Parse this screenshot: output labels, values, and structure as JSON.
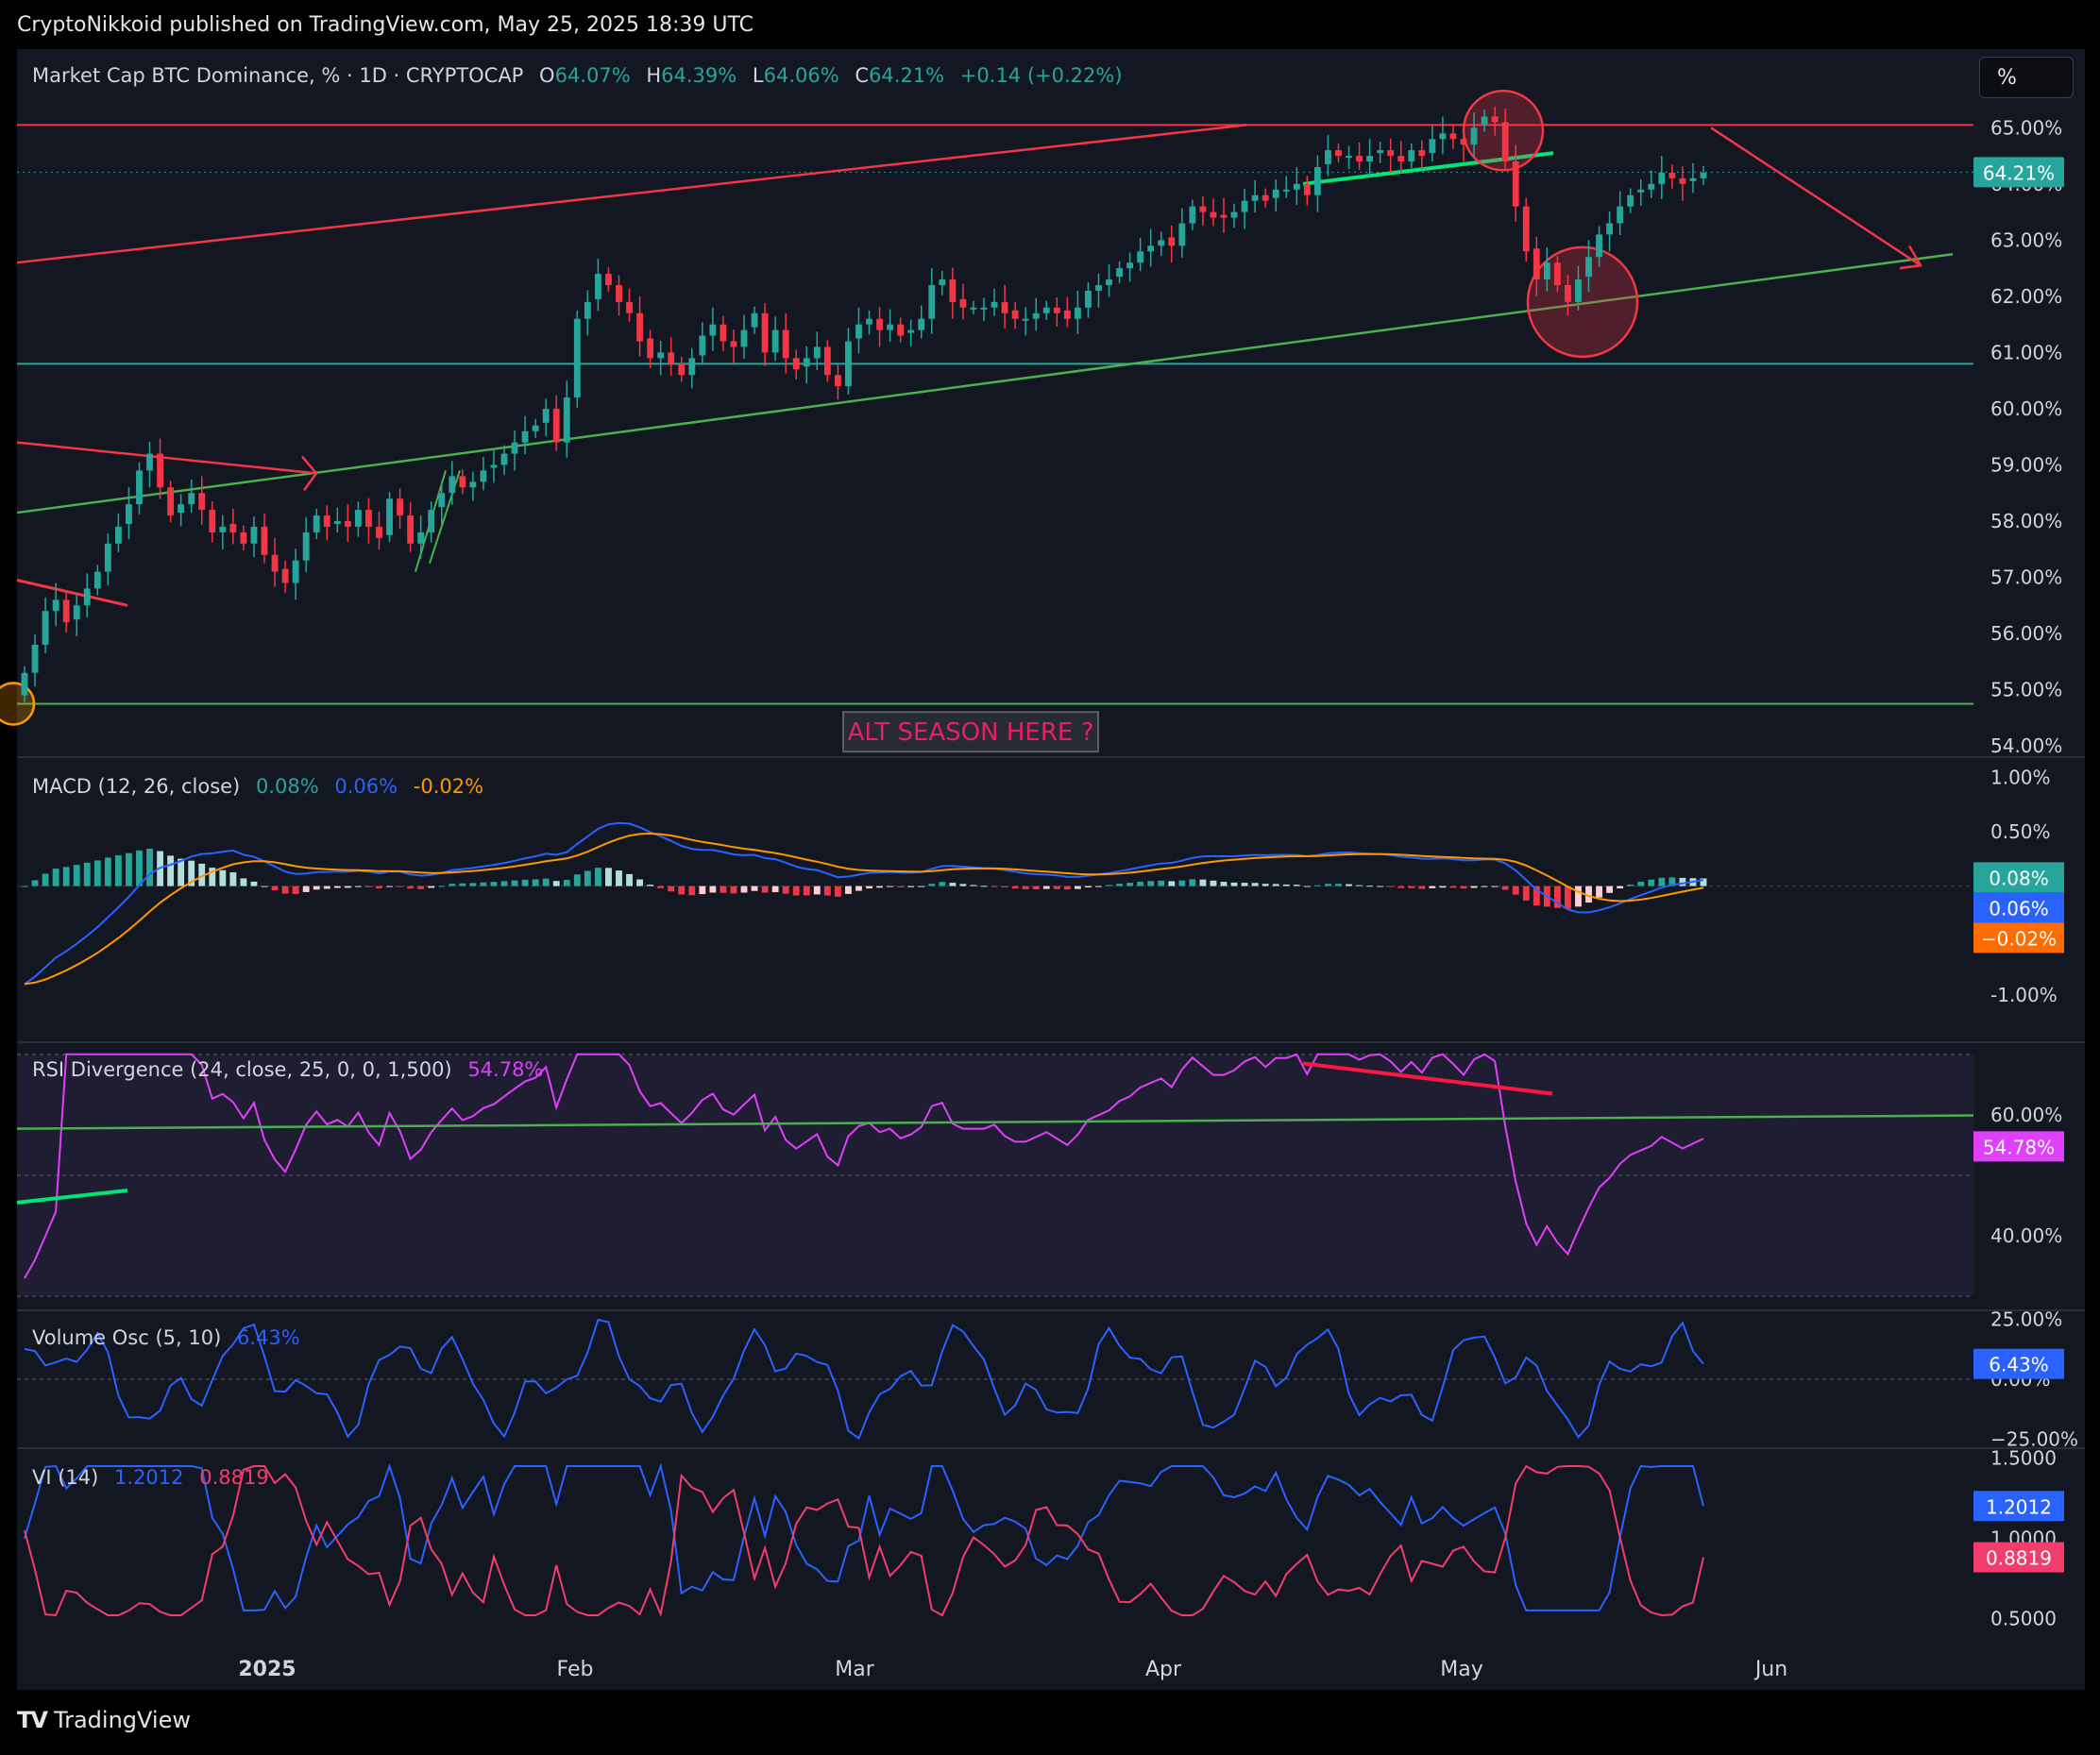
{
  "header": {
    "publisher_line": "CryptoNikkoid published on TradingView.com, May 25, 2025 18:39 UTC",
    "brand": "TradingView",
    "scale_button": "%"
  },
  "colors": {
    "background": "#131722",
    "up": "#26a69a",
    "down": "#f23645",
    "macd": "#2962ff",
    "signal": "#ff9800",
    "rsi": "#e040fb",
    "vosc": "#2962ff",
    "vi_plus": "#2962ff",
    "vi_minus": "#f23d6d",
    "trend_red": "#f23645",
    "trend_green": "#4caf50",
    "support_teal": "#26a69a",
    "annotation_pink": "#e91e63"
  },
  "chart_data": [
    {
      "type": "candlestick",
      "legend": {
        "title": "Market Cap BTC Dominance, % · 1D · CRYPTOCAP",
        "o_label": "O",
        "o_value": "64.07%",
        "h_label": "H",
        "h_value": "64.39%",
        "l_label": "L",
        "l_value": "64.06%",
        "c_label": "C",
        "c_value": "64.21%",
        "change": "+0.14 (+0.22%)"
      },
      "ylim": [
        53.8,
        66.4
      ],
      "y_ticks": [
        "65.00%",
        "64.00%",
        "63.00%",
        "62.00%",
        "61.00%",
        "60.00%",
        "59.00%",
        "58.00%",
        "57.00%",
        "56.00%",
        "55.00%",
        "54.00%"
      ],
      "y_tick_values": [
        65,
        64,
        63,
        62,
        61,
        60,
        59,
        58,
        57,
        56,
        55,
        54
      ],
      "last_price_label": "64.21%",
      "last_price": 64.21,
      "x_labels": [
        "2025",
        "Feb",
        "Mar",
        "Apr",
        "May",
        "Jun"
      ],
      "annotation": "ALT SEASON HERE ?",
      "close": [
        55.3,
        55.8,
        56.4,
        56.6,
        56.2,
        56.5,
        56.8,
        57.1,
        57.6,
        57.9,
        58.3,
        58.9,
        59.2,
        58.6,
        58.1,
        58.3,
        58.5,
        58.2,
        57.8,
        57.9,
        57.8,
        57.6,
        57.9,
        57.4,
        57.1,
        56.9,
        57.3,
        57.8,
        58.1,
        57.9,
        58.0,
        57.9,
        58.2,
        57.9,
        57.7,
        58.4,
        58.1,
        57.6,
        57.8,
        58.2,
        58.5,
        58.8,
        58.6,
        58.7,
        58.9,
        59.0,
        59.2,
        59.4,
        59.6,
        59.7,
        60.0,
        59.4,
        60.2,
        61.6,
        61.9,
        62.4,
        62.2,
        61.9,
        61.7,
        61.2,
        60.9,
        61.0,
        60.8,
        60.6,
        60.9,
        61.3,
        61.5,
        61.2,
        61.1,
        61.4,
        61.7,
        61.0,
        61.4,
        60.9,
        60.7,
        60.9,
        61.1,
        60.6,
        60.4,
        61.2,
        61.5,
        61.6,
        61.4,
        61.5,
        61.3,
        61.4,
        61.6,
        62.2,
        62.3,
        61.9,
        61.8,
        61.8,
        61.8,
        61.9,
        61.7,
        61.6,
        61.6,
        61.7,
        61.8,
        61.7,
        61.6,
        61.8,
        62.1,
        62.2,
        62.3,
        62.5,
        62.6,
        62.8,
        62.9,
        63.0,
        62.9,
        63.3,
        63.6,
        63.5,
        63.4,
        63.4,
        63.5,
        63.7,
        63.8,
        63.7,
        63.9,
        63.9,
        64.0,
        63.8,
        64.3,
        64.6,
        64.5,
        64.5,
        64.4,
        64.5,
        64.6,
        64.5,
        64.4,
        64.6,
        64.5,
        64.8,
        64.9,
        64.8,
        64.7,
        65.0,
        65.2,
        65.1,
        64.4,
        63.6,
        62.8,
        62.3,
        62.6,
        62.2,
        61.9,
        62.3,
        62.7,
        63.1,
        63.3,
        63.6,
        63.8,
        63.9,
        64.0,
        64.2,
        64.1,
        64.0,
        64.1,
        64.2
      ]
    },
    {
      "type": "line",
      "legend": {
        "title": "MACD (12, 26, close)",
        "hist": "0.08%",
        "macd": "0.06%",
        "signal": "-0.02%"
      },
      "ylim": [
        -1.4,
        1.15
      ],
      "y_ticks": [
        "1.00%",
        "0.50%",
        "-1.00%"
      ],
      "y_tick_values": [
        1.0,
        0.5,
        -1.0
      ],
      "last_labels": {
        "hist": "0.08%",
        "macd": "0.06%",
        "signal": "−0.02%"
      }
    },
    {
      "type": "line",
      "legend": {
        "title": "RSI Divergence (24, close, 25, 0, 0, 1,500)",
        "value": "54.78%"
      },
      "ylim": [
        28,
        72
      ],
      "y_ticks": [
        "60.00%",
        "40.00%"
      ],
      "y_tick_values": [
        60,
        40
      ],
      "last_label": "54.78%"
    },
    {
      "type": "line",
      "legend": {
        "title": "Volume Osc (5, 10)",
        "value": "6.43%"
      },
      "ylim": [
        -28,
        28
      ],
      "y_ticks": [
        "25.00%",
        "0.00%",
        "−25.00%"
      ],
      "y_tick_values": [
        25,
        0,
        -25
      ],
      "last_label": "6.43%"
    },
    {
      "type": "line",
      "legend": {
        "title": "VI (14)",
        "vi_plus": "1.2012",
        "vi_minus": "0.8819"
      },
      "ylim": [
        0.42,
        1.55
      ],
      "y_ticks": [
        "1.5000",
        "1.0000",
        "0.5000"
      ],
      "y_tick_values": [
        1.5,
        1.0,
        0.5
      ],
      "last_labels": {
        "vi_plus": "1.2012",
        "vi_minus": "0.8819"
      }
    }
  ]
}
